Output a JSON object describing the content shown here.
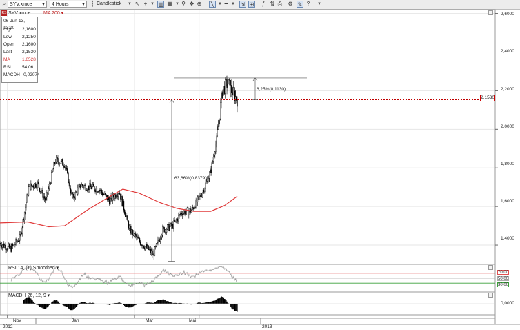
{
  "toolbar": {
    "symbol_value": "SYV:xmce",
    "interval_value": "4 Hours",
    "chart_type_label": "Candlestick"
  },
  "price_pane": {
    "symbol_badge": "RS",
    "symbol_title": "SYV:xmce",
    "ma_title": "MA 200 ▾",
    "last_price_tag": "2,1530",
    "pct_annotation_upper": "6,25%(0,1130)",
    "pct_annotation_lower": "63,66%(0,8379)"
  },
  "info_box": {
    "timestamp": "06-Jun-13, 13:00",
    "rows": [
      {
        "label": "High",
        "value": "2,1600"
      },
      {
        "label": "Low",
        "value": "2,1250"
      },
      {
        "label": "Open",
        "value": "2,1600"
      },
      {
        "label": "Last",
        "value": "2,1530"
      },
      {
        "label": "MA",
        "value": "1,6528"
      },
      {
        "label": "RSI",
        "value": "54,06"
      },
      {
        "label": "MACDH",
        "value": "-0,02074"
      }
    ]
  },
  "price_axis": [
    "2,6000",
    "2,4000",
    "2,2000",
    "2,0000",
    "1,8000",
    "1,6000",
    "1,4000"
  ],
  "rsi_pane": {
    "title": "RSI 14, (1) Smoothed ▾",
    "levels": [
      "70,00",
      "50,00",
      "30,00"
    ]
  },
  "macd_pane": {
    "title": "MACDH 26, 12, 9 ▾",
    "axis_label": "0,0000"
  },
  "time_axis": {
    "months": [
      "Nov",
      "Jan",
      "Mar",
      "Mai"
    ],
    "years": [
      "2012",
      "2013"
    ]
  },
  "colors": {
    "ma_line": "#e03a3a",
    "last_price_line": "#c00000",
    "candles": "#000000",
    "rsi_70": "#e05050",
    "rsi_50": "#aaaaaa",
    "rsi_30": "#3aa03a"
  },
  "chart_data": {
    "type": "candlestick",
    "x_range": [
      "2012-10-25",
      "2013-06-06"
    ],
    "ylim": [
      1.3,
      2.62
    ],
    "price_path": [
      [
        "2012-10-26",
        1.41
      ],
      [
        "2012-11-05",
        1.38
      ],
      [
        "2012-11-14",
        1.44
      ],
      [
        "2012-11-22",
        1.7
      ],
      [
        "2012-11-30",
        1.72
      ],
      [
        "2012-12-08",
        1.63
      ],
      [
        "2012-12-17",
        1.84
      ],
      [
        "2012-12-26",
        1.82
      ],
      [
        "2013-01-02",
        1.64
      ],
      [
        "2013-01-10",
        1.71
      ],
      [
        "2013-01-18",
        1.7
      ],
      [
        "2013-01-27",
        1.69
      ],
      [
        "2013-02-06",
        1.63
      ],
      [
        "2013-02-15",
        1.68
      ],
      [
        "2013-02-25",
        1.48
      ],
      [
        "2013-03-06",
        1.42
      ],
      [
        "2013-03-14",
        1.38
      ],
      [
        "2013-03-19",
        1.35
      ],
      [
        "2013-03-28",
        1.48
      ],
      [
        "2013-04-06",
        1.5
      ],
      [
        "2013-04-15",
        1.57
      ],
      [
        "2013-04-24",
        1.58
      ],
      [
        "2013-05-03",
        1.66
      ],
      [
        "2013-05-12",
        1.78
      ],
      [
        "2013-05-18",
        1.96
      ],
      [
        "2013-05-23",
        2.2
      ],
      [
        "2013-05-28",
        2.24
      ],
      [
        "2013-06-01",
        2.2
      ],
      [
        "2013-06-06",
        2.153
      ]
    ],
    "ma_200": [
      [
        "2012-10-25",
        1.515
      ],
      [
        "2012-11-20",
        1.52
      ],
      [
        "2012-12-10",
        1.495
      ],
      [
        "2012-12-25",
        1.5
      ],
      [
        "2013-01-15",
        1.58
      ],
      [
        "2013-02-05",
        1.65
      ],
      [
        "2013-02-18",
        1.69
      ],
      [
        "2013-03-05",
        1.67
      ],
      [
        "2013-03-25",
        1.62
      ],
      [
        "2013-04-10",
        1.59
      ],
      [
        "2013-04-26",
        1.575
      ],
      [
        "2013-05-12",
        1.575
      ],
      [
        "2013-05-25",
        1.605
      ],
      [
        "2013-06-06",
        1.6528
      ]
    ],
    "last_price": 2.153,
    "measure_upper": {
      "from": 2.153,
      "to": 2.266
    },
    "measure_lower": {
      "from": 1.316,
      "to": 2.153
    }
  }
}
